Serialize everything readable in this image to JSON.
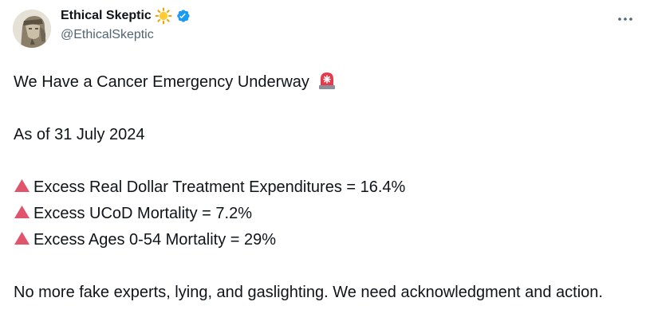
{
  "author": {
    "name": "Ethical Skeptic",
    "handle": "@EthicalSkeptic",
    "avatar_icon": "pharaoh-portrait-avatar",
    "name_emoji_icon": "sun-icon",
    "verified_icon": "verified-badge-icon"
  },
  "menu": {
    "icon": "more-horizontal-icon"
  },
  "tweet": {
    "headline": "We Have a Cancer Emergency Underway",
    "headline_icon": "police-light-siren-icon",
    "date_line": "As of 31 July 2024",
    "bullet_icon": "red-triangle-up-icon",
    "bullets": [
      "Excess Real Dollar Treatment Expenditures = 16.4%",
      "Excess UCoD Mortality = 7.2%",
      "Excess Ages 0-54 Mortality = 29%"
    ],
    "closing": "No more fake experts, lying, and gaslighting. We need acknowledgment and action."
  },
  "colors": {
    "text": "#0f1419",
    "secondary": "#536471",
    "verified": "#1d9bf0",
    "triangle": "#e0556b"
  }
}
